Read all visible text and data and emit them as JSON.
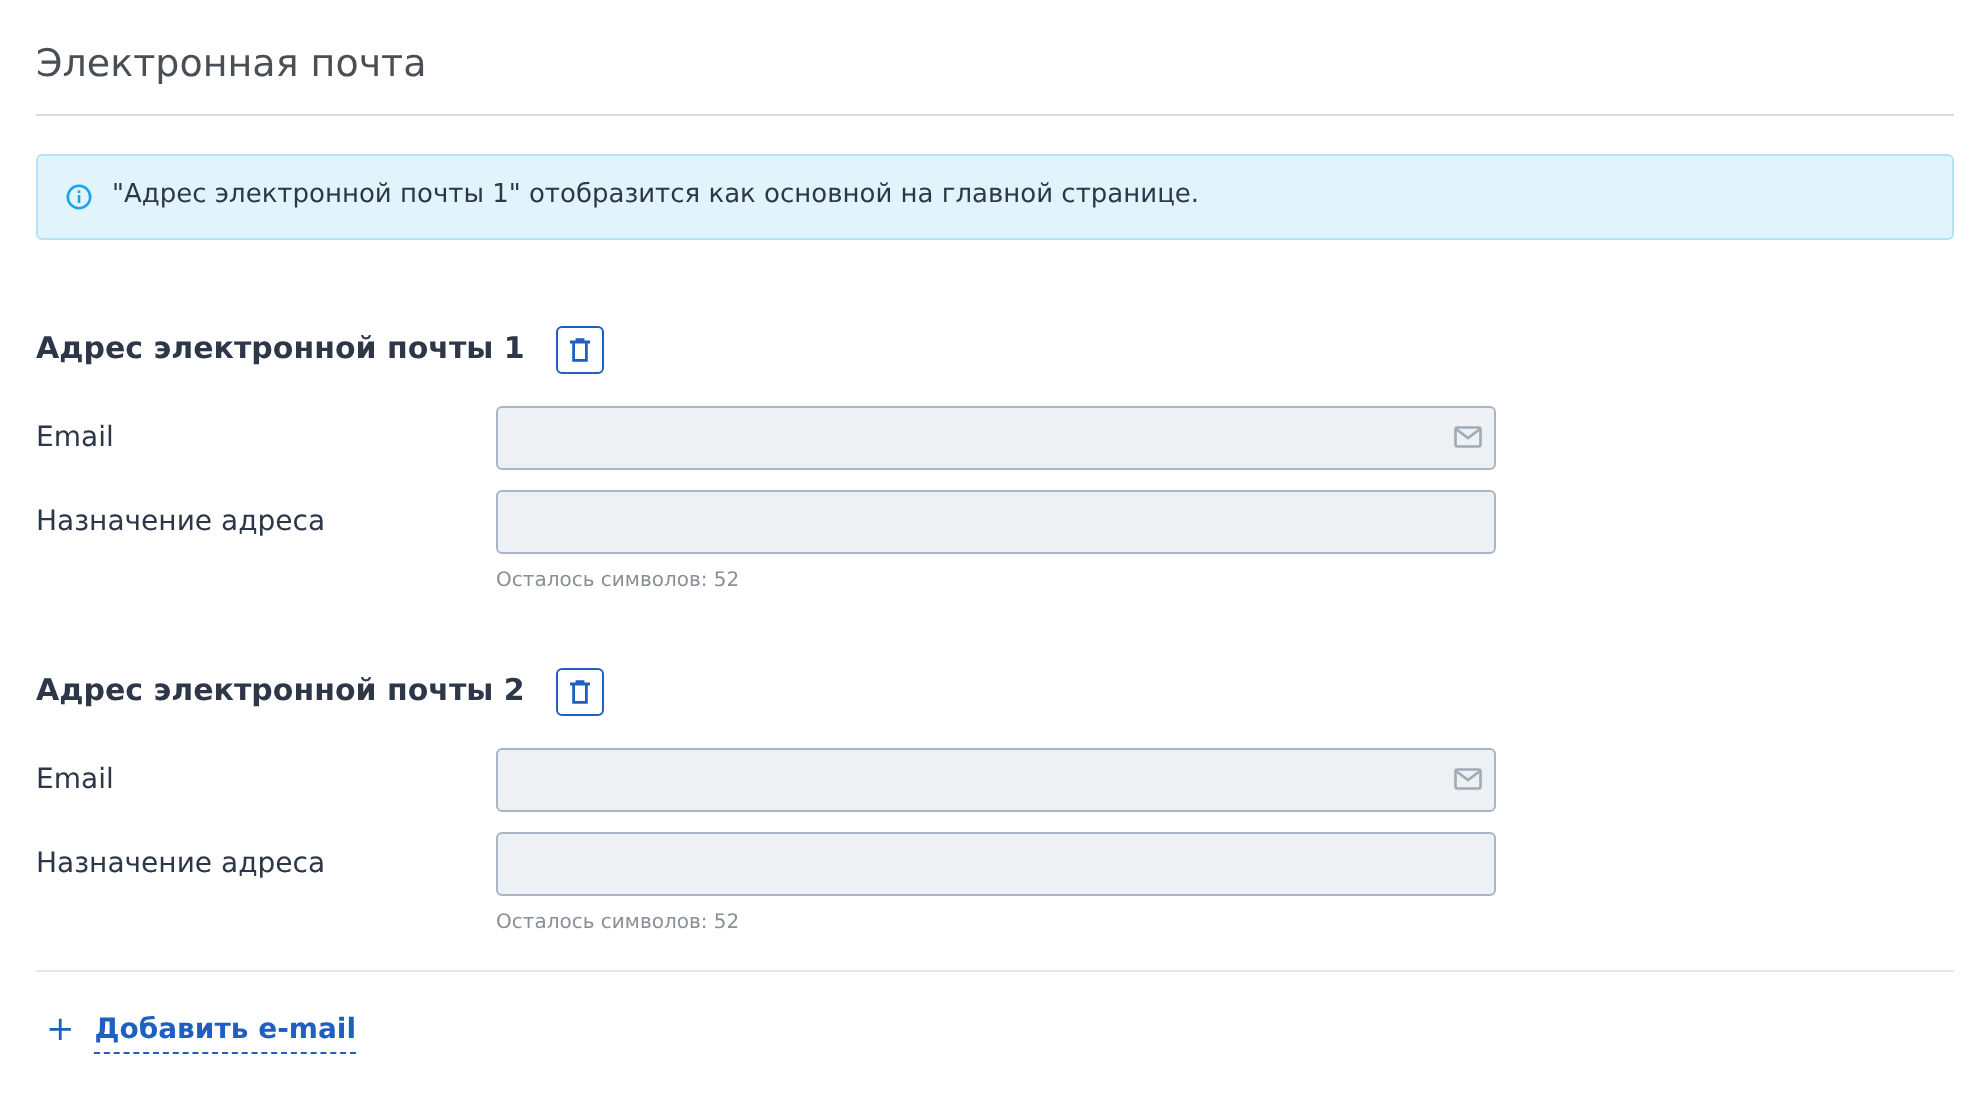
{
  "title": "Электронная почта",
  "info": "\"Адрес электронной почты 1\" отобразится как основной на главной странице.",
  "addresses": [
    {
      "heading": "Адрес электронной почты 1",
      "fields": [
        {
          "kind": "email",
          "label": "Email",
          "disabled": true
        },
        {
          "kind": "text",
          "label": "Назначение адреса",
          "disabled": true,
          "hint": "Осталось символов: 52"
        }
      ]
    },
    {
      "heading": "Адрес электронной почты 2",
      "fields": [
        {
          "kind": "email",
          "label": "Email",
          "disabled": true
        },
        {
          "kind": "text",
          "label": "Назначение адреса",
          "disabled": true,
          "hint": "Осталось символов: 52"
        }
      ]
    }
  ],
  "add_link": {
    "icon": "+",
    "label": "Добавить e-mail"
  }
}
